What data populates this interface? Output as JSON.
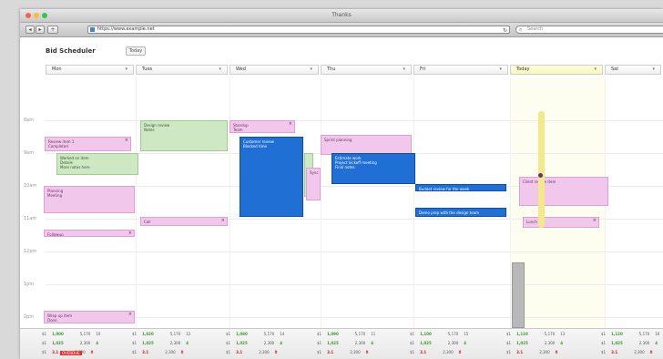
{
  "window": {
    "title": "Thanks"
  },
  "traffic_colors": {
    "close": "#fc5f57",
    "minimize": "#fdbc2e",
    "zoom": "#34c84a"
  },
  "toolbar": {
    "back": "◂",
    "forward": "▸",
    "share": "+",
    "url": "https://www.example.net",
    "reload": "↻",
    "search_placeholder": "Search"
  },
  "page": {
    "title": "Bid Scheduler",
    "button_label": "Today"
  },
  "columns": [
    {
      "label": "Mon",
      "today": false
    },
    {
      "label": "Tues",
      "today": false
    },
    {
      "label": "Wed",
      "today": false
    },
    {
      "label": "Thu",
      "today": false
    },
    {
      "label": "Fri",
      "today": false
    },
    {
      "label": "Today",
      "today": true
    },
    {
      "label": "Sat",
      "today": false
    }
  ],
  "times": [
    "8am",
    "9am",
    "10am",
    "11am",
    "12pm",
    "1pm",
    "2pm",
    "3pm"
  ],
  "events": [
    {
      "id": "e1",
      "color": "pink",
      "text": "Review item 1\nCompleted"
    },
    {
      "id": "e2",
      "color": "green",
      "text": "Worked on item\nDetails\nMore notes here"
    },
    {
      "id": "e3",
      "color": "pink",
      "text": "Planning\nMeeting"
    },
    {
      "id": "e4",
      "color": "pink",
      "text": "Followup"
    },
    {
      "id": "e5",
      "color": "pink",
      "text": "Wrap up item\nDone"
    },
    {
      "id": "e6",
      "color": "green",
      "text": "Design review\nNotes"
    },
    {
      "id": "e7",
      "color": "pink",
      "text": "Call"
    },
    {
      "id": "e8",
      "color": "pink",
      "text": "Standup\nTeam"
    },
    {
      "id": "e9",
      "color": "blue",
      "text": "Customer review\nBlocked time"
    },
    {
      "id": "e10",
      "color": "green",
      "text": ""
    },
    {
      "id": "e11",
      "color": "pink",
      "text": "Sync"
    },
    {
      "id": "e12",
      "color": "pink",
      "text": "Sprint planning"
    },
    {
      "id": "e13",
      "color": "blue",
      "text": "Estimate work\nProject kickoff meeting\nFinal notes"
    },
    {
      "id": "e14",
      "color": "blue",
      "text": "Budget review for the week"
    },
    {
      "id": "e15",
      "color": "blue",
      "text": "Demo prep with the design team"
    },
    {
      "id": "e16",
      "color": "pink",
      "text": "Client review item"
    },
    {
      "id": "e17",
      "color": "pink",
      "text": "Lunch"
    },
    {
      "id": "e18",
      "color": "gray",
      "text": ""
    }
  ],
  "footer": [
    {
      "a": "$1",
      "b": "1,000",
      "c": "5,170",
      "d": "10",
      "e": "1,025",
      "f": "3.1",
      "g": "4",
      "h": "2,300",
      "i": "0"
    },
    {
      "a": "$1",
      "b": "1,020",
      "c": "5,170",
      "d": "12",
      "e": "1,025",
      "f": "3.1",
      "g": "4",
      "h": "2,300",
      "i": "0"
    },
    {
      "a": "$1",
      "b": "1,080",
      "c": "5,170",
      "d": "14",
      "e": "1,025",
      "f": "3.1",
      "g": "4",
      "h": "2,300",
      "i": "0"
    },
    {
      "a": "$1",
      "b": "1,090",
      "c": "5,170",
      "d": "11",
      "e": "1,025",
      "f": "3.1",
      "g": "4",
      "h": "2,300",
      "i": "0"
    },
    {
      "a": "$1",
      "b": "1,100",
      "c": "5,170",
      "d": "15",
      "e": "1,025",
      "f": "3.1",
      "g": "4",
      "h": "2,300",
      "i": "0"
    },
    {
      "a": "$1",
      "b": "1,110",
      "c": "5,170",
      "d": "13",
      "e": "1,025",
      "f": "3.1",
      "g": "4",
      "h": "2,300",
      "i": "0"
    },
    {
      "a": "$1",
      "b": "1,120",
      "c": "5,170",
      "d": "16",
      "e": "1,025",
      "f": "3.1",
      "g": "4",
      "h": "2,300",
      "i": "0"
    }
  ],
  "footer_flag": "OVERDUE"
}
